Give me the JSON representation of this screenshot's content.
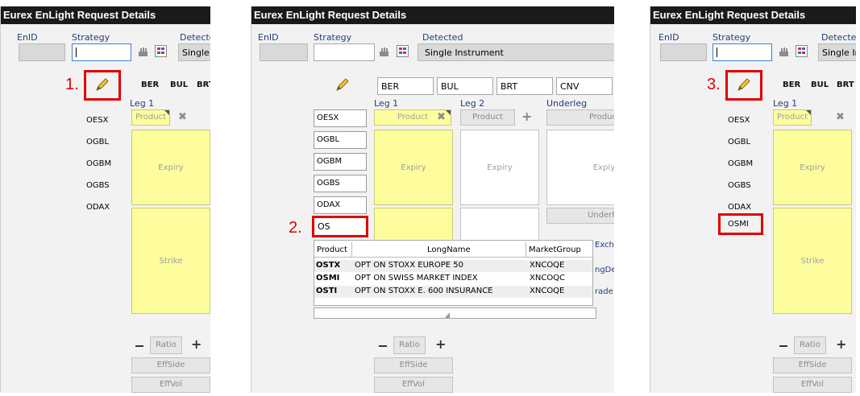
{
  "title": "Eurex EnLight Request Details",
  "labels": {
    "enid": "EnID",
    "strategy": "Strategy",
    "detected": "Detected",
    "detected_clip1": "Detectec",
    "detected_clip3": "Detectec",
    "leg1": "Leg 1",
    "leg2": "Leg 2",
    "underleg": "Underleg"
  },
  "detected_value": "Single Instrument",
  "detected_value_clip1": "Single I",
  "detected_value_clip3": "Single Ir",
  "exchange_codes": [
    "BER",
    "BUL",
    "BRT",
    "CNV"
  ],
  "products": [
    "OESX",
    "OGBL",
    "OGBM",
    "OGBS",
    "ODAX"
  ],
  "cells": {
    "product": "Product",
    "expiry": "Expiry",
    "expiry_clip": "Expiy",
    "strike": "Strike",
    "product_clip": "Produc",
    "underp_clip": "UnderF"
  },
  "buttons": {
    "ratio": "Ratio",
    "effside": "EffSide",
    "effvol": "EffVol"
  },
  "steps": [
    "1.",
    "2.",
    "3."
  ],
  "search_input_value": "OS",
  "selected_product": "OSMI",
  "dropdown": {
    "headers": [
      "Product",
      "LongName",
      "MarketGroup"
    ],
    "rows": [
      {
        "product": "OSTX",
        "longname": "OPT ON STOXX EUROPE 50",
        "group": "XNCOQE"
      },
      {
        "product": "OSMI",
        "longname": "OPT ON SWISS MARKET INDEX",
        "group": "XNCOQC"
      },
      {
        "product": "OSTI",
        "longname": "OPT ON STOXX E. 600 INSURANCE",
        "group": "XNCOQE"
      }
    ]
  },
  "clipped_side_labels": [
    "Exch",
    "ngDe",
    "rade"
  ],
  "colors": {
    "highlight": "#e00000",
    "leg_yellow": "#fdfd9e",
    "titlebar": "#1a1a1a"
  }
}
